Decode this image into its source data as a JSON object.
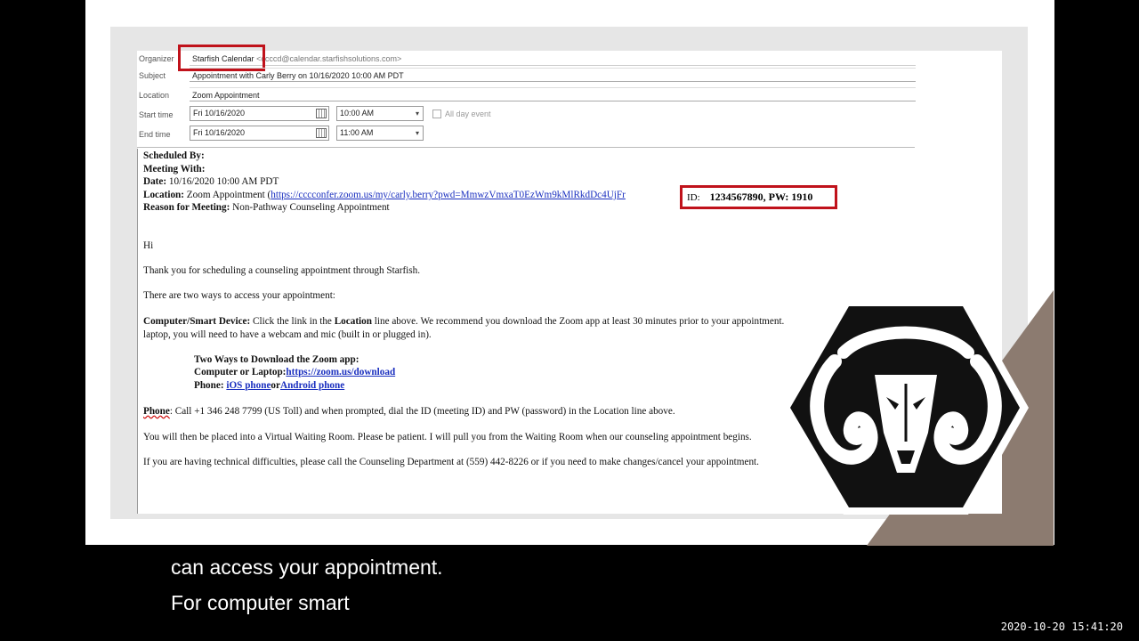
{
  "header": {
    "organizer_label": "Organizer",
    "organizer_name": "Starfish Calendar",
    "organizer_email": "<ccccd@calendar.starfishsolutions.com>",
    "subject_label": "Subject",
    "subject_value": "Appointment with Carly Berry on 10/16/2020 10:00 AM PDT",
    "location_label": "Location",
    "location_value": "Zoom Appointment",
    "start_label": "Start time",
    "start_date": "Fri 10/16/2020",
    "start_time": "10:00 AM",
    "all_day_label": "All day event",
    "end_label": "End time",
    "end_date": "Fri 10/16/2020",
    "end_time": "11:00 AM"
  },
  "body": {
    "scheduled_by": "Scheduled By:",
    "meeting_with": "Meeting With:",
    "date_label": "Date:",
    "date_value": "10/16/2020 10:00 AM PDT",
    "location_label": "Location:",
    "location_text": "Zoom Appointment (",
    "location_link": "https://cccconfer.zoom.us/my/carly.berry?pwd=MmwzVmxaT0EzWm9kMlRkdDc4UjFr",
    "meeting_id_label": "ID:",
    "meeting_id_value": "1234567890, PW: 1910",
    "reason_label": "Reason for Meeting:",
    "reason_value": "Non-Pathway Counseling Appointment",
    "greeting": "Hi",
    "thanks": "Thank you for scheduling a counseling appointment through Starfish.",
    "two_ways": "There are two ways to access your appointment:",
    "computer_label": "Computer/Smart Device:",
    "computer_text_1": "Click the link in the",
    "computer_text_loc": "Location",
    "computer_text_2": "line above. We recommend you download the Zoom app at least 30 minutes prior to your appointment.",
    "computer_text_line2": "laptop, you will need to have a webcam and mic (built in or plugged in).",
    "download_title": "Two Ways to Download the Zoom app:",
    "download_computer_label": "Computer or Laptop:",
    "download_computer_link": "https://zoom.us/download",
    "download_phone_label": "Phone:",
    "download_ios_link": "iOS phone",
    "download_or": "or",
    "download_android_link": "Android phone",
    "phone_label": "Phone",
    "phone_text": ": Call +1 346 248 7799 (US Toll) and when prompted, dial the ID (meeting ID) and PW (password) in the Location line above.",
    "waiting_text": "You will then be placed into a Virtual Waiting Room. Please be patient. I will pull you from the Waiting Room when our counseling appointment begins.",
    "difficulties_text": "If you are having technical difficulties, please call the Counseling Department at (559) 442-8226 or if you need to make changes/cancel your appointment."
  },
  "subtitles": {
    "line1": "can access your appointment.",
    "line2": "For computer smart"
  },
  "timestamp": "2020-10-20  15:41:20",
  "logo_icon": "ram-logo-icon",
  "colors": {
    "highlight": "#c0121b",
    "link": "#1a2fbf",
    "accent_brown": "#8c7b70"
  }
}
